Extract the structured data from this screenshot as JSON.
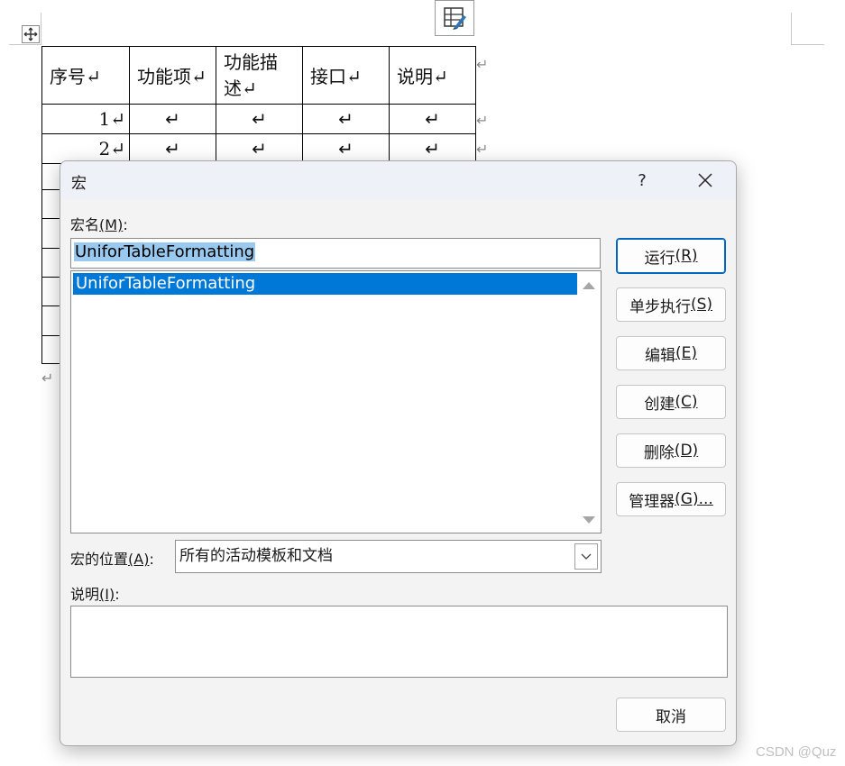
{
  "document": {
    "table": {
      "headers": [
        "序号↵",
        "功能项↵",
        "功能描述↵",
        "接口↵",
        "说明↵"
      ],
      "header_lines": [
        [
          "序号↵"
        ],
        [
          "功能项↵"
        ],
        [
          "功能描",
          "述↵"
        ],
        [
          "接口↵"
        ],
        [
          "说明↵"
        ]
      ],
      "rows": [
        [
          "1↵",
          "↵",
          "↵",
          "↵",
          "↵"
        ],
        [
          "2↵",
          "↵",
          "↵",
          "↵",
          "↵"
        ]
      ],
      "row_end_mark": "↵"
    },
    "paragraph_mark": "↵"
  },
  "dialog": {
    "title": "宏",
    "help_label": "?",
    "macro_name_label": "宏名",
    "macro_name_hotkey": "(M)",
    "macro_name_value": "UniforTableFormatting",
    "macro_list": [
      "UniforTableFormatting"
    ],
    "buttons": {
      "run": {
        "text": "运行",
        "hotkey": "(R)"
      },
      "step_into": {
        "text": "单步执行",
        "hotkey": "(S)"
      },
      "edit": {
        "text": "编辑",
        "hotkey": "(E)"
      },
      "create": {
        "text": "创建",
        "hotkey": "(C)"
      },
      "delete": {
        "text": "删除",
        "hotkey": "(D)"
      },
      "organizer": {
        "text": "管理器",
        "hotkey": "(G)..."
      },
      "cancel": {
        "text": "取消"
      }
    },
    "location_label": "宏的位置",
    "location_hotkey": "(A)",
    "location_value": "所有的活动模板和文档",
    "description_label": "说明",
    "description_hotkey": "(I)",
    "description_value": ""
  },
  "watermark": "CSDN @Quz",
  "colors": {
    "selection_blue": "#0078d7",
    "selection_light": "#99c9ef",
    "primary_border": "#0067c0"
  }
}
